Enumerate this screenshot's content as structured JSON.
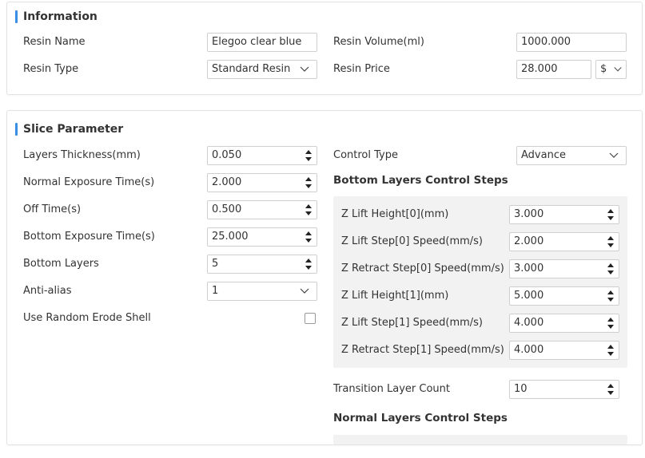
{
  "information": {
    "title": "Information",
    "resin_name_label": "Resin Name",
    "resin_name_value": "Elegoo clear blue",
    "resin_type_label": "Resin Type",
    "resin_type_value": "Standard Resin",
    "resin_volume_label": "Resin Volume(ml)",
    "resin_volume_value": "1000.000",
    "resin_price_label": "Resin Price",
    "resin_price_value": "28.000",
    "currency_value": "$"
  },
  "slice": {
    "title": "Slice Parameter",
    "layers_thickness_label": "Layers Thickness(mm)",
    "layers_thickness_value": "0.050",
    "normal_exposure_label": "Normal Exposure Time(s)",
    "normal_exposure_value": "2.000",
    "off_time_label": "Off Time(s)",
    "off_time_value": "0.500",
    "bottom_exposure_label": "Bottom Exposure Time(s)",
    "bottom_exposure_value": "25.000",
    "bottom_layers_label": "Bottom Layers",
    "bottom_layers_value": "5",
    "anti_alias_label": "Anti-alias",
    "anti_alias_value": "1",
    "random_erode_label": "Use Random Erode Shell",
    "control_type_label": "Control Type",
    "control_type_value": "Advance",
    "bottom_steps_title": "Bottom Layers Control Steps",
    "steps": [
      {
        "label": "Z Lift Height[0](mm)",
        "value": "3.000"
      },
      {
        "label": "Z Lift Step[0] Speed(mm/s)",
        "value": "2.000"
      },
      {
        "label": "Z Retract Step[0] Speed(mm/s)",
        "value": "3.000"
      },
      {
        "label": "Z Lift Height[1](mm)",
        "value": "5.000"
      },
      {
        "label": "Z Lift Step[1] Speed(mm/s)",
        "value": "4.000"
      },
      {
        "label": "Z Retract Step[1] Speed(mm/s)",
        "value": "4.000"
      }
    ],
    "transition_label": "Transition Layer Count",
    "transition_value": "10",
    "normal_steps_title": "Normal Layers Control Steps"
  },
  "colors": {
    "accent": "#3a8ee6",
    "panel_bg": "#f2f2f2",
    "border": "#cfcfcf"
  }
}
